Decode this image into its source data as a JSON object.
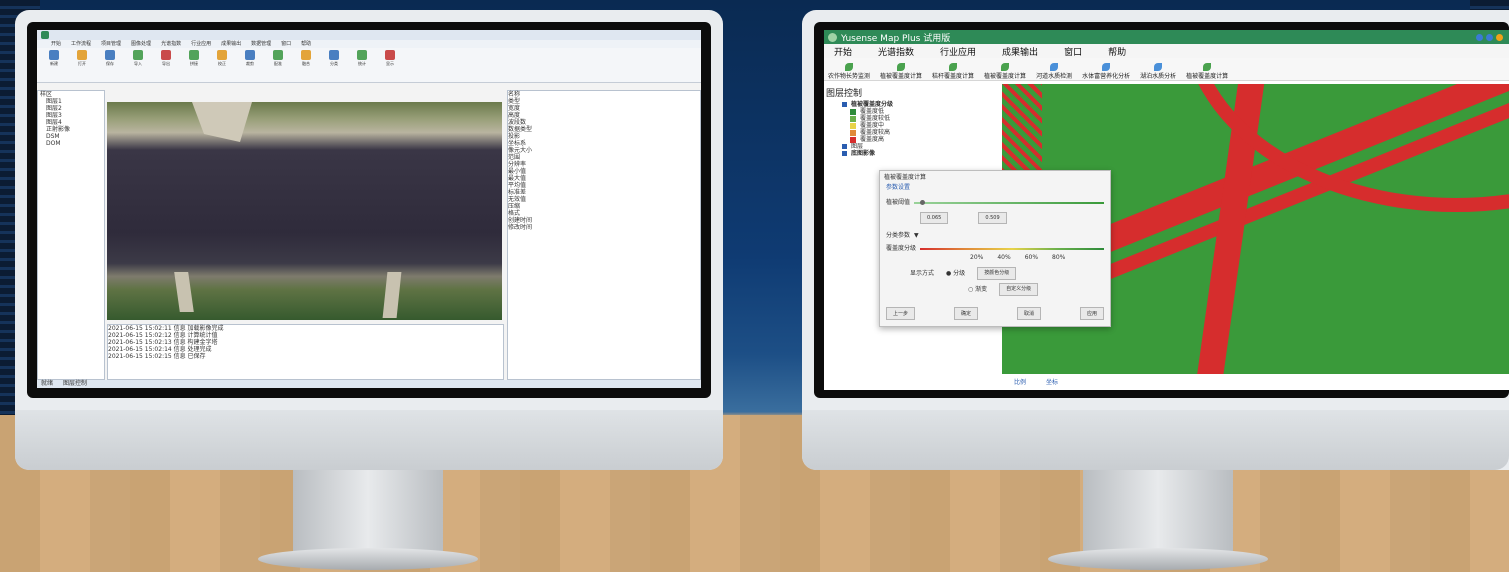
{
  "left_app": {
    "menu": [
      "开始",
      "工作流程",
      "项目管理",
      "图像处理",
      "光谱指数",
      "行业应用",
      "成果输出",
      "数据管理",
      "窗口",
      "帮助"
    ],
    "ribbon": [
      "新建",
      "打开",
      "保存",
      "导入",
      "导出",
      "拼接",
      "校正",
      "裁剪",
      "配准",
      "融合",
      "分类",
      "统计",
      "显示"
    ],
    "tree": [
      "样区",
      "图层1",
      "图层2",
      "图层3",
      "图层4",
      "正射影像",
      "DSM",
      "DOM"
    ],
    "props": [
      "名称",
      "类型",
      "宽度",
      "高度",
      "波段数",
      "数据类型",
      "投影",
      "坐标系",
      "像元大小",
      "范围",
      "分辨率",
      "最小值",
      "最大值",
      "平均值",
      "标准差",
      "无效值",
      "压缩",
      "格式",
      "创建时间",
      "修改时间"
    ],
    "log_lines": [
      "2021-06-15 15:02:11 信息 加载影像完成",
      "2021-06-15 15:02:12 信息 计算统计值",
      "2021-06-15 15:02:13 信息 构建金字塔",
      "2021-06-15 15:02:14 信息 处理完成",
      "2021-06-15 15:02:15 信息 已保存"
    ],
    "status": [
      "就绪",
      "图层控制"
    ]
  },
  "right_app": {
    "title": "Yusense Map Plus 试用版",
    "menu": [
      "开始",
      "光谱指数",
      "行业应用",
      "成果输出",
      "窗口",
      "帮助"
    ],
    "tools": [
      "农作物长势监测",
      "植被覆盖度计算",
      "秸秆覆盖度计算",
      "植被覆盖度计算",
      "河道水质检测",
      "水体富营养化分析",
      "湖泊水质分析",
      "植被覆盖度计算"
    ],
    "panel_title": "图层控制",
    "layers": [
      "植被覆盖度分级",
      "覆盖度低",
      "覆盖度较低",
      "覆盖度中",
      "覆盖度较高",
      "覆盖度高",
      "图层",
      "底图影像"
    ],
    "legend_colors": [
      "#2e8b3a",
      "#6ab04c",
      "#e8d34a",
      "#e08a3a",
      "#d62d2d"
    ],
    "dialog": {
      "title": "植被覆盖度计算",
      "tab": "参数设置",
      "field1": "植被阈值",
      "val1": "0.065",
      "val2": "0.509",
      "field2": "分类参数",
      "field3": "覆盖度分级",
      "ticks": [
        "20%",
        "40%",
        "60%",
        "80%"
      ],
      "radio_label": "显示方式",
      "radio1": "分级",
      "radio2": "渐变",
      "opt1": "按颜色分级",
      "opt2": "自定义分级",
      "buttons": [
        "上一步",
        "确定",
        "取消",
        "应用"
      ]
    },
    "status": [
      "比例",
      "坐标"
    ]
  }
}
